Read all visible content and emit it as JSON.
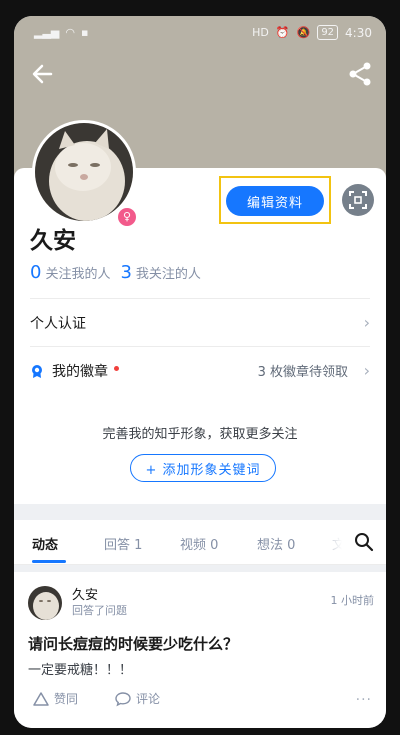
{
  "status_bar": {
    "left_icons": [
      "signal-icon",
      "wifi-icon",
      "notification-icon"
    ],
    "right_icons": [
      "hd-icon",
      "alarm-icon",
      "silent-icon"
    ],
    "battery": "92",
    "time": "4:30"
  },
  "header": {
    "back_icon": "back-arrow-icon",
    "share_icon": "share-icon"
  },
  "profile": {
    "name": "久安",
    "gender_icon": "female-icon",
    "edit_button": "编辑资料",
    "qr_icon": "scan-icon",
    "followers_count": "0",
    "followers_label": "关注我的人",
    "following_count": "3",
    "following_label": "我关注的人"
  },
  "rows": {
    "verification": "个人认证",
    "badges_label": "我的徽章",
    "badges_status": "3 枚徽章待领取"
  },
  "prompt": {
    "hint": "完善我的知乎形象，获取更多关注",
    "add_keyword": "+ 添加形象关键词"
  },
  "tabs": [
    {
      "label": "动态"
    },
    {
      "label": "回答 1"
    },
    {
      "label": "视频 0"
    },
    {
      "label": "想法 0"
    },
    {
      "label": "文"
    }
  ],
  "feed": {
    "author": "久安",
    "action": "回答了问题",
    "time": "1 小时前",
    "question": "请问长痘痘的时候要少吃什么？",
    "excerpt": "一定要戒糖！！！",
    "upvote_label": "赞同",
    "comment_label": "评论"
  },
  "colors": {
    "accent": "#1677ff",
    "highlight_box": "#f2c311",
    "cover": "#b7b2a6"
  }
}
